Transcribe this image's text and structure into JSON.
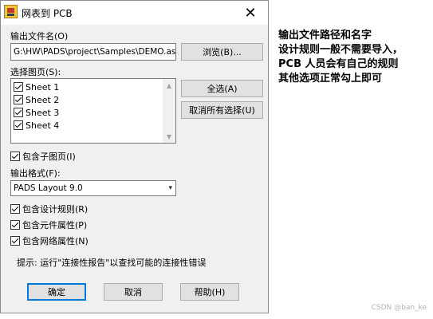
{
  "window": {
    "title": "网表到 PCB",
    "close_symbol": "✕"
  },
  "output_file": {
    "label": "输出文件名(O)",
    "value": "G:\\HW\\PADS\\project\\Samples\\DEMO.asc",
    "browse_label": "浏览(B)..."
  },
  "sheets": {
    "label": "选择图页(S):",
    "items": [
      {
        "label": "Sheet 1",
        "checked": true
      },
      {
        "label": "Sheet 2",
        "checked": true
      },
      {
        "label": "Sheet 3",
        "checked": true
      },
      {
        "label": "Sheet 4",
        "checked": true
      }
    ],
    "select_all_label": "全选(A)",
    "deselect_all_label": "取消所有选择(U)"
  },
  "include_sub_sheets": {
    "label": "包含子图页(I)",
    "checked": true
  },
  "output_format": {
    "label": "输出格式(F):",
    "selected": "PADS Layout 9.0"
  },
  "options": [
    {
      "label": "包含设计规则(R)",
      "checked": true
    },
    {
      "label": "包含元件属性(P)",
      "checked": true
    },
    {
      "label": "包含网络属性(N)",
      "checked": true
    }
  ],
  "hint": "提示: 运行\"连接性报告\"以查找可能的连接性错误",
  "buttons": {
    "ok": "确定",
    "cancel": "取消",
    "help": "帮助(H)"
  },
  "annotation": {
    "lines": [
      "输出文件路径和名字",
      "设计规则一般不需要导入，",
      "PCB 人员会有自己的规则",
      "其他选项正常勾上即可"
    ]
  },
  "watermark": "CSDN @ban_ke"
}
